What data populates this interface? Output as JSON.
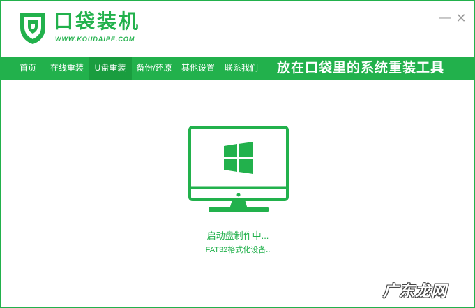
{
  "app": {
    "name": "口袋装机",
    "url": "WWW.KOUDAIPE.COM"
  },
  "window_controls": {
    "minimize": "—",
    "close": "✕"
  },
  "nav": {
    "items": [
      {
        "label": "首页"
      },
      {
        "label": "在线重装"
      },
      {
        "label": "U盘重装",
        "active": true
      },
      {
        "label": "备份/还原"
      },
      {
        "label": "其他设置"
      },
      {
        "label": "联系我们"
      }
    ],
    "slogan": "放在口袋里的系统重装工具"
  },
  "main": {
    "status": "启动盘制作中...",
    "substatus": "FAT32格式化设备.."
  },
  "watermark": "广东龙网",
  "icons": {
    "logo": "pocket-shield-logo",
    "monitor": "windows-monitor-icon"
  },
  "colors": {
    "accent": "#22b14c",
    "nav_active": "#1a9d3f"
  }
}
